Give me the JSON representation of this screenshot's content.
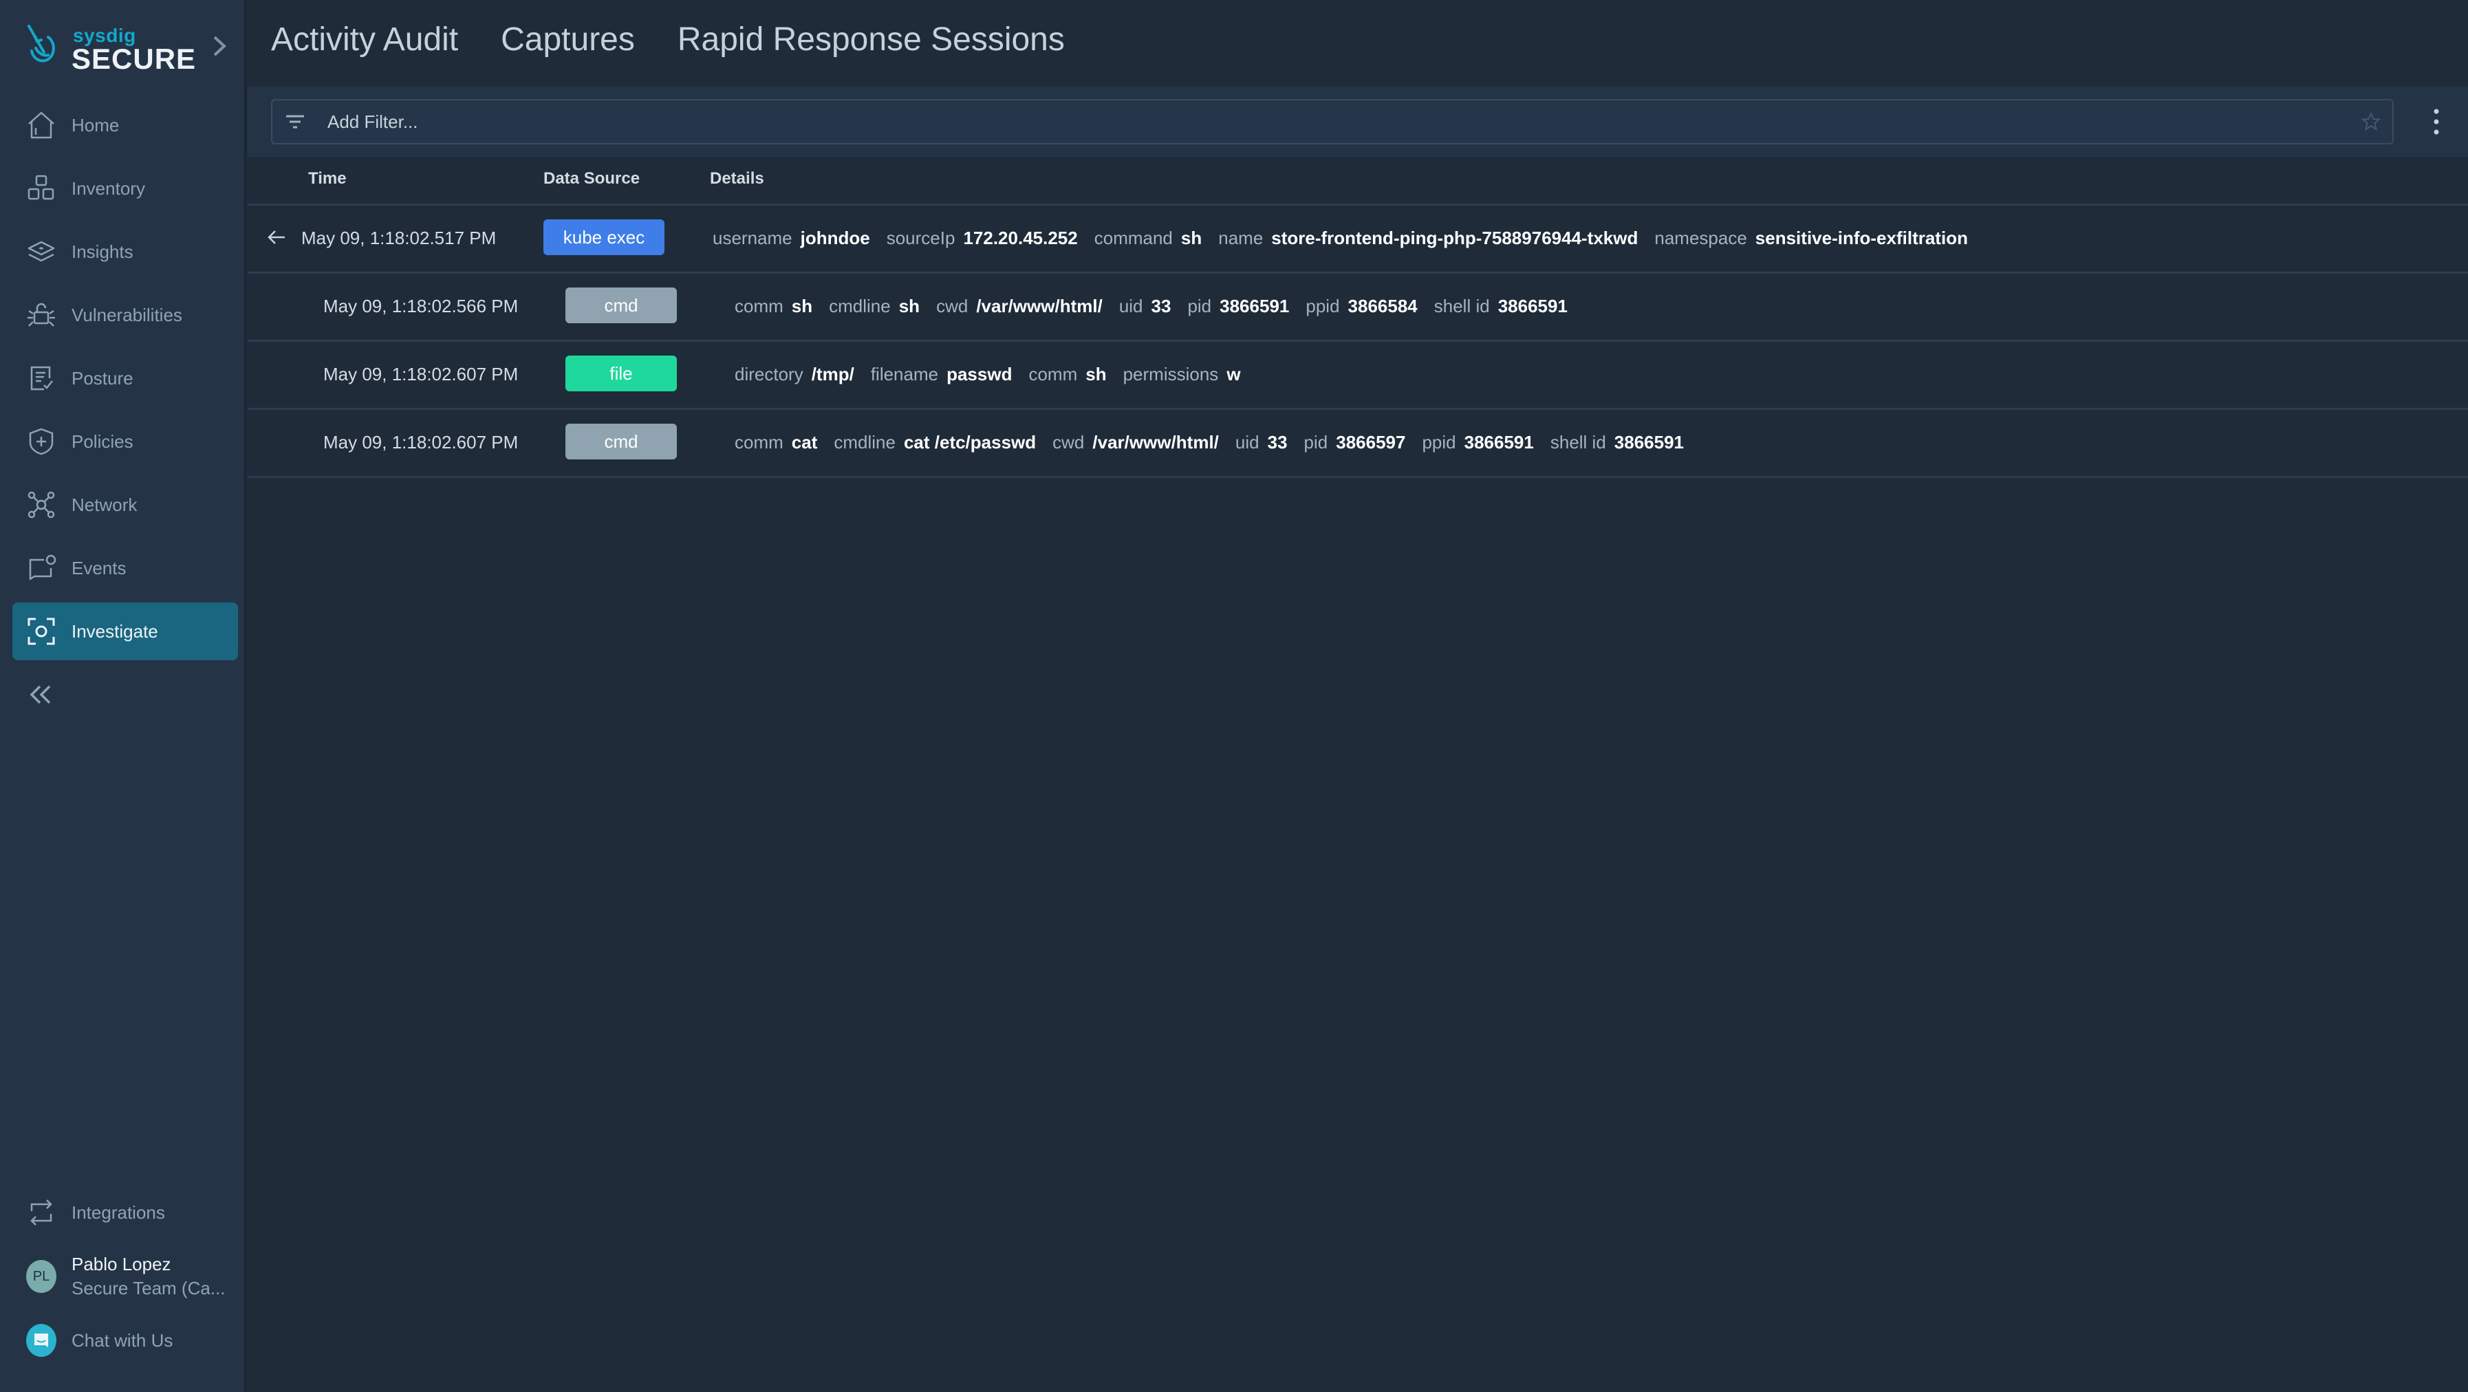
{
  "brand": {
    "top": "sysdig",
    "product": "SECURE",
    "accent": "#13a8cc"
  },
  "sidebar": {
    "items": [
      {
        "label": "Home",
        "icon": "home-icon"
      },
      {
        "label": "Inventory",
        "icon": "inventory-icon"
      },
      {
        "label": "Insights",
        "icon": "insights-icon"
      },
      {
        "label": "Vulnerabilities",
        "icon": "vulnerabilities-icon"
      },
      {
        "label": "Posture",
        "icon": "posture-icon"
      },
      {
        "label": "Policies",
        "icon": "policies-icon"
      },
      {
        "label": "Network",
        "icon": "network-icon"
      },
      {
        "label": "Events",
        "icon": "events-icon"
      },
      {
        "label": "Investigate",
        "icon": "investigate-icon",
        "active": true
      }
    ],
    "bottom": {
      "integrations": "Integrations",
      "user": {
        "initials": "PL",
        "name": "Pablo Lopez",
        "team": "Secure Team (Ca..."
      },
      "chat": "Chat with Us"
    }
  },
  "tabs": [
    "Activity Audit",
    "Captures",
    "Rapid Response Sessions"
  ],
  "filter": {
    "placeholder": "Add Filter..."
  },
  "table": {
    "headers": {
      "time": "Time",
      "source": "Data Source",
      "details": "Details"
    },
    "rows": [
      {
        "time": "May 09, 1:18:02.517 PM",
        "source": "kube exec",
        "source_color": "#3f7ee8",
        "details": [
          [
            "username",
            "johndoe"
          ],
          [
            "sourceIp",
            "172.20.45.252"
          ],
          [
            "command",
            "sh"
          ],
          [
            "name",
            "store-frontend-ping-php-7588976944-txkwd"
          ],
          [
            "namespace",
            "sensitive-info-exfiltration"
          ]
        ]
      },
      {
        "time": "May 09, 1:18:02.566 PM",
        "source": "cmd",
        "source_color": "#8fa3b0",
        "details": [
          [
            "comm",
            "sh"
          ],
          [
            "cmdline",
            "sh"
          ],
          [
            "cwd",
            "/var/www/html/"
          ],
          [
            "uid",
            "33"
          ],
          [
            "pid",
            "3866591"
          ],
          [
            "ppid",
            "3866584"
          ],
          [
            "shell id",
            "3866591"
          ]
        ]
      },
      {
        "time": "May 09, 1:18:02.607 PM",
        "source": "file",
        "source_color": "#1fd89c",
        "details": [
          [
            "directory",
            "/tmp/"
          ],
          [
            "filename",
            "passwd"
          ],
          [
            "comm",
            "sh"
          ],
          [
            "permissions",
            "w"
          ]
        ]
      },
      {
        "time": "May 09, 1:18:02.607 PM",
        "source": "cmd",
        "source_color": "#8fa3b0",
        "details": [
          [
            "comm",
            "cat"
          ],
          [
            "cmdline",
            "cat /etc/passwd"
          ],
          [
            "cwd",
            "/var/www/html/"
          ],
          [
            "uid",
            "33"
          ],
          [
            "pid",
            "3866597"
          ],
          [
            "ppid",
            "3866591"
          ],
          [
            "shell id",
            "3866591"
          ]
        ]
      }
    ]
  }
}
